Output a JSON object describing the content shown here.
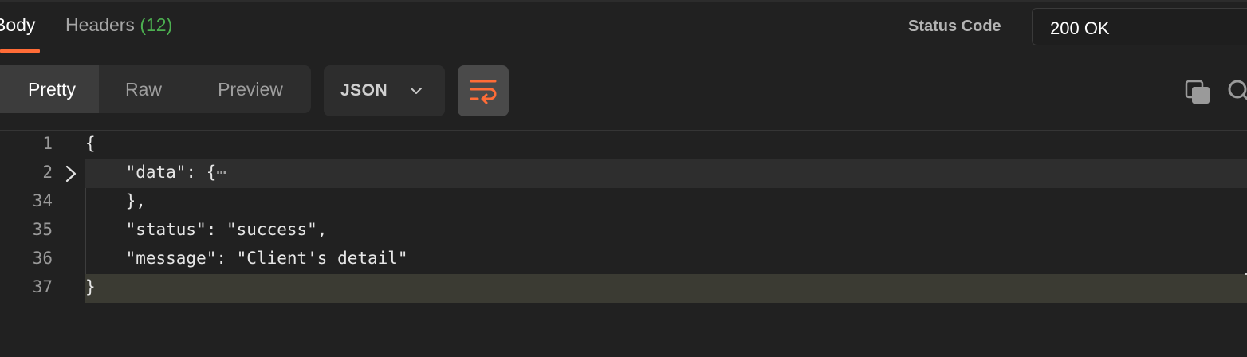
{
  "tabs": {
    "body_label": "Body",
    "headers_label": "Headers",
    "headers_count": "(12)"
  },
  "status": {
    "label": "Status Code",
    "value": "200 OK"
  },
  "toolbar": {
    "modes": [
      "Pretty",
      "Raw",
      "Preview"
    ],
    "active_mode": "Pretty",
    "format": "JSON"
  },
  "icons": {
    "chevron": "chevron-down-icon",
    "wrap": "wrap-lines-icon",
    "copy": "copy-icon",
    "search": "search-icon"
  },
  "colors": {
    "accent": "#ff6c37",
    "count": "#4caf50",
    "background": "#212121"
  },
  "editor": {
    "lines": [
      {
        "num": "1",
        "text": "{"
      },
      {
        "num": "2",
        "text": "    \"data\": {",
        "ellipsis": "⋯",
        "folded": true
      },
      {
        "num": "34",
        "text": "    },"
      },
      {
        "num": "35",
        "text": "    \"status\": \"success\","
      },
      {
        "num": "36",
        "text": "    \"message\": \"Client's detail\""
      },
      {
        "num": "37",
        "text": "}"
      }
    ]
  }
}
